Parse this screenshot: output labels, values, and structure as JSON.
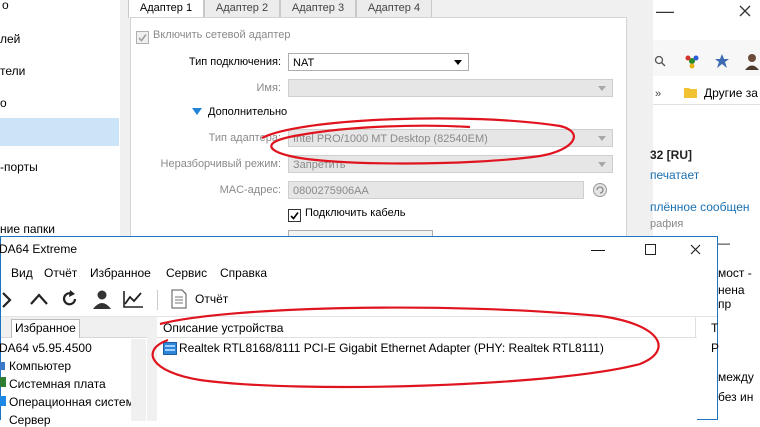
{
  "vbox_sidebar": {
    "items": [
      "лей",
      "тели",
      "о",
      "-порты",
      "ние папки"
    ]
  },
  "vbox_settings": {
    "tabs": [
      "Адаптер 1",
      "Адаптер 2",
      "Адаптер 3",
      "Адаптер 4"
    ],
    "enable_adapter": "Включить сетевой адаптер",
    "attached_to_label": "Тип подключения:",
    "attached_to_value": "NAT",
    "name_label": "Имя:",
    "advanced_label": "Дополнительно",
    "adapter_type_label": "Тип адаптера:",
    "adapter_type_value": "Intel PRO/1000 MT Desktop (82540EM)",
    "promisc_label": "Неразборчивый режим:",
    "promisc_value": "Запретить",
    "mac_label": "MAC-адрес:",
    "mac_value": "0800275906AA",
    "cable_label": "Подключить кабель"
  },
  "browser": {
    "bookmark": "Другие за",
    "post_num": "32 [RU]",
    "printing": "печатает",
    "pinned": "плённое сообщен",
    "graph": "рафия",
    "bridge": "мост -",
    "replaced": "нена пр",
    "between": "между",
    "without": "без ин"
  },
  "aida": {
    "title": "DA64 Extreme",
    "menu": [
      "Вид",
      "Отчёт",
      "Избранное",
      "Сервис",
      "Справка"
    ],
    "report_button": "Отчёт",
    "tree_tab": "Избранное",
    "tree_root": "DA64 v5.95.4500",
    "tree_items": [
      "Компьютер",
      "Системная плата",
      "Операционная систем",
      "Сервер"
    ],
    "list_header": "Описание устройства",
    "list_header_2": "Т",
    "device": "Realtek RTL8168/8111 PCI-E Gigabit Ethernet Adapter (PHY: Realtek RTL8111)",
    "device_col2": "Р"
  },
  "colors": {
    "annotation_red": "#e0141e",
    "accent_blue": "#1c73c4",
    "selection": "#cce4f7"
  }
}
